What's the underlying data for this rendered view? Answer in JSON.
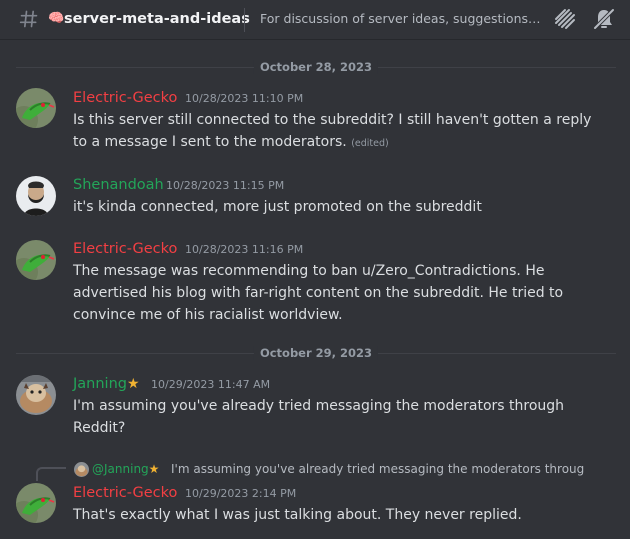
{
  "header": {
    "channel_name": "server-meta-and-ideas",
    "topic": "For discussion of server ideas, suggestions, a...",
    "icons": [
      "hash-icon",
      "brain-icon",
      "threads-icon",
      "mute-bell-icon"
    ]
  },
  "dividers": [
    "October 28, 2023",
    "October 29, 2023"
  ],
  "messages": [
    {
      "author": "Electric-Gecko",
      "timestamp": "10/28/2023 11:10 PM",
      "text": "Is this server still connected to the subreddit? I still haven't gotten a reply to a message I sent to the moderators.",
      "edited": "(edited)"
    },
    {
      "author": "Shenandoah",
      "timestamp": "10/28/2023 11:15 PM",
      "text": "it's kinda connected, more just promoted on the subreddit"
    },
    {
      "author": "Electric-Gecko",
      "timestamp": "10/28/2023 11:16 PM",
      "text": "The message was recommending to ban u/Zero_Contradictions. He advertised his blog with far-right content on the subreddit. He tried to convince me of his racialist worldview."
    },
    {
      "author": "Janning",
      "timestamp": "10/29/2023 11:47 AM",
      "text": "I'm assuming you've already tried messaging the moderators through Reddit?"
    },
    {
      "author": "Electric-Gecko",
      "timestamp": "10/29/2023 2:14 PM",
      "text": "That's exactly what I was just talking about. They never replied.",
      "reply_to": {
        "name": "@Janning",
        "text": "I'm assuming you've already tried messaging the moderators through Reddit?"
      }
    }
  ],
  "colors": {
    "background": "#313338",
    "author_red": "#f23f43",
    "author_green": "#23a559",
    "text": "#dbdee1",
    "muted": "#949ba4",
    "star": "#f0b232"
  }
}
